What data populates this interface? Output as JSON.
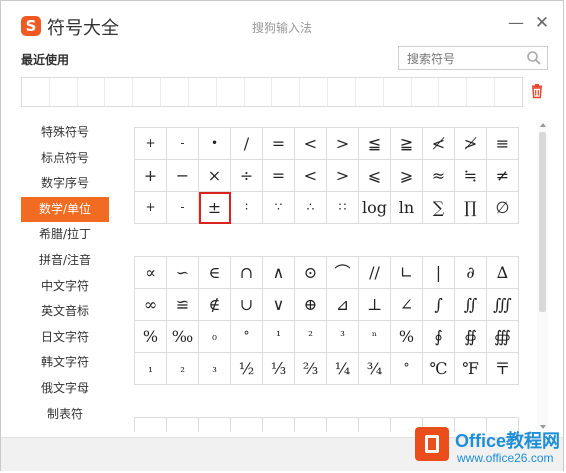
{
  "window": {
    "logo_glyph": "S",
    "app_title": "符号大全",
    "ime_title": "搜狗输入法",
    "minimize_glyph": "—",
    "close_glyph": "✕"
  },
  "recent": {
    "label": "最近使用",
    "search_placeholder": "搜索符号",
    "cells": 18
  },
  "sidebar": {
    "items": [
      {
        "label": "特殊符号",
        "active": false
      },
      {
        "label": "标点符号",
        "active": false
      },
      {
        "label": "数字序号",
        "active": false
      },
      {
        "label": "数学/单位",
        "active": true
      },
      {
        "label": "希腊/拉丁",
        "active": false
      },
      {
        "label": "拼音/注音",
        "active": false
      },
      {
        "label": "中文字符",
        "active": false
      },
      {
        "label": "英文音标",
        "active": false
      },
      {
        "label": "日文字符",
        "active": false
      },
      {
        "label": "韩文字符",
        "active": false
      },
      {
        "label": "俄文字母",
        "active": false
      },
      {
        "label": "制表符",
        "active": false
      }
    ]
  },
  "grid1": {
    "rows": [
      [
        "+",
        "-",
        "•",
        "/",
        "=",
        "<",
        ">",
        "≦",
        "≧",
        "≮",
        "≯",
        "≡"
      ],
      [
        "+",
        "−",
        "×",
        "÷",
        "=",
        "<",
        ">",
        "⩽",
        "⩾",
        "≈",
        "≒",
        "≠"
      ],
      [
        "+",
        "-",
        "±",
        "∶",
        "∵",
        "∴",
        "∷",
        "log",
        "ln",
        "∑",
        "∏",
        "∅"
      ]
    ],
    "selected": [
      2,
      2
    ]
  },
  "grid2": {
    "rows": [
      [
        "∝",
        "∽",
        "∈",
        "∩",
        "∧",
        "⊙",
        "⌒",
        "//",
        "∟",
        "|",
        "∂",
        "∆"
      ],
      [
        "∞",
        "≌",
        "∉",
        "∪",
        "∨",
        "⊕",
        "⊿",
        "⊥",
        "∠",
        "∫",
        "∬",
        "∭"
      ],
      [
        "%",
        "‰",
        "₀",
        "°",
        "¹",
        "²",
        "³",
        "ⁿ",
        "%",
        "∮",
        "∯",
        "∰"
      ],
      [
        "₁",
        "₂",
        "₃",
        "½",
        "⅓",
        "⅔",
        "¼",
        "¾",
        "°",
        "℃",
        "℉",
        "〒"
      ]
    ]
  },
  "watermark": {
    "title": "Office教程网",
    "url": "www.office26.com"
  },
  "colors": {
    "accent": "#f26b22",
    "selected_border": "#d9231c",
    "watermark": "#1e8fd6"
  }
}
